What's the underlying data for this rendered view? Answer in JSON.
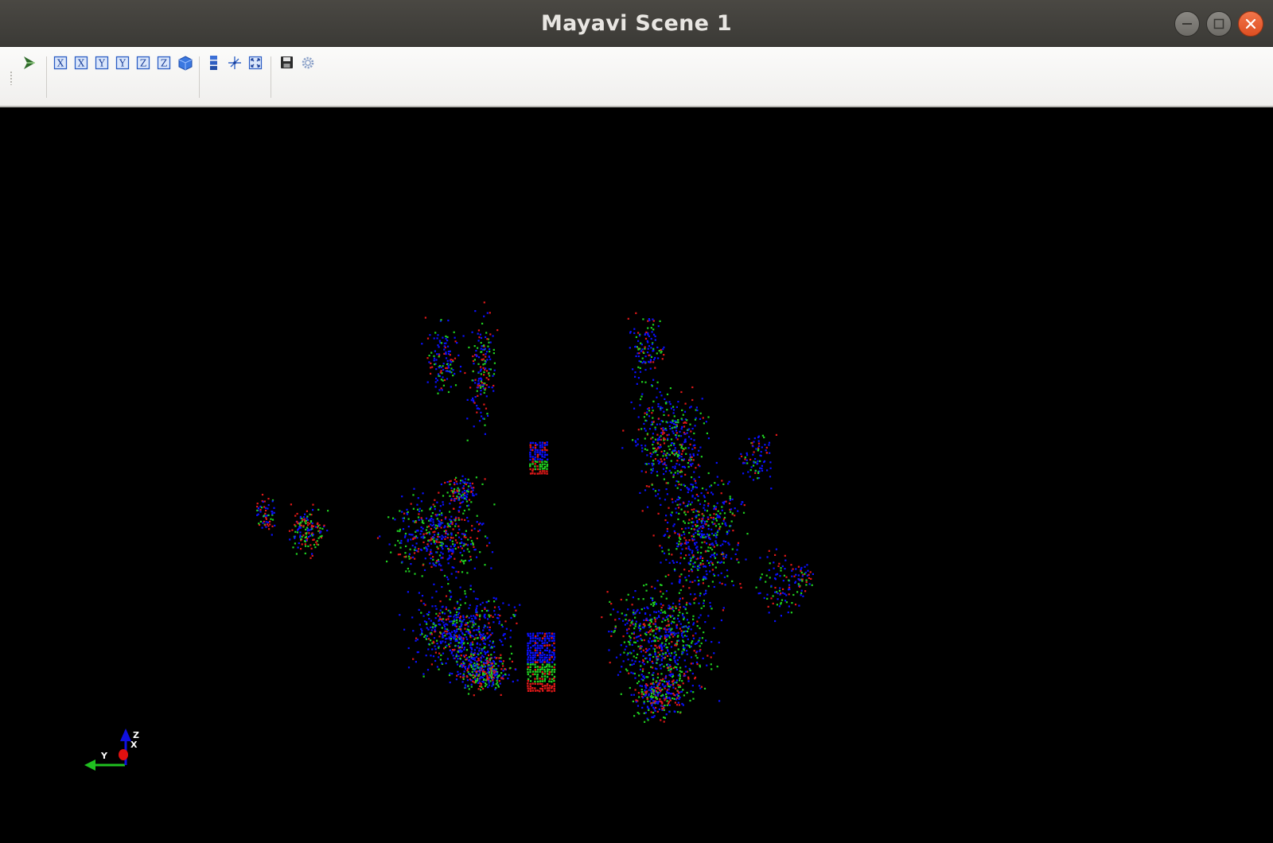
{
  "window": {
    "title": "Mayavi Scene 1",
    "controls": [
      "minimize",
      "maximize",
      "close"
    ]
  },
  "toolbar": {
    "groups": [
      [
        "pipeline-icon"
      ],
      [
        "view-x-plus-icon",
        "view-x-minus-icon",
        "view-y-plus-icon",
        "view-y-minus-icon",
        "view-z-plus-icon",
        "view-z-minus-icon",
        "isometric-view-icon"
      ],
      [
        "parallel-projection-icon",
        "toggle-axes-icon",
        "full-screen-icon"
      ],
      [
        "save-icon",
        "settings-icon"
      ]
    ],
    "view_letters": [
      "X",
      "X",
      "Y",
      "Y",
      "Z",
      "Z"
    ]
  },
  "scene": {
    "background": "#000000",
    "point_colors": [
      "#0a10ff",
      "#20d020",
      "#e01818"
    ]
  },
  "axes": {
    "x_label": "X",
    "y_label": "Y",
    "z_label": "Z",
    "colors": {
      "x": "#e01010",
      "y": "#20c020",
      "z": "#1010e0"
    }
  }
}
